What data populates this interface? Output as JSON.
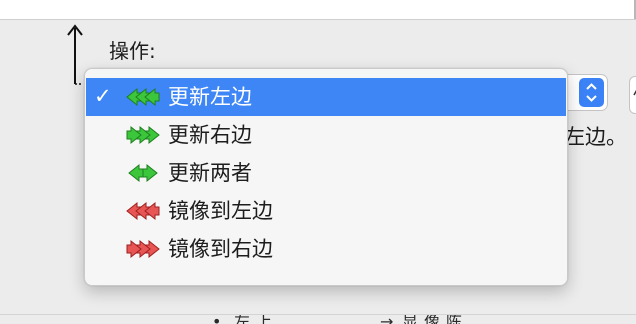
{
  "panel": {
    "label": "操作:",
    "background_text": "左边。",
    "bottom_cut_glyphs": [
      "•",
      "左",
      "上",
      "→",
      "显",
      "像",
      "陈"
    ]
  },
  "menu": {
    "checkmark": "✓",
    "items": [
      {
        "label": "更新左边",
        "icon": "double-arrow-left-green-icon",
        "selected": true
      },
      {
        "label": "更新右边",
        "icon": "double-arrow-right-green-icon",
        "selected": false
      },
      {
        "label": "更新两者",
        "icon": "double-arrow-both-green-icon",
        "selected": false
      },
      {
        "label": "镜像到左边",
        "icon": "double-arrow-left-red-icon",
        "selected": false
      },
      {
        "label": "镜像到右边",
        "icon": "double-arrow-right-red-icon",
        "selected": false
      }
    ]
  },
  "colors": {
    "selection": "#3e86f5",
    "green_arrow": "#3cc63c",
    "red_arrow": "#e85555"
  }
}
